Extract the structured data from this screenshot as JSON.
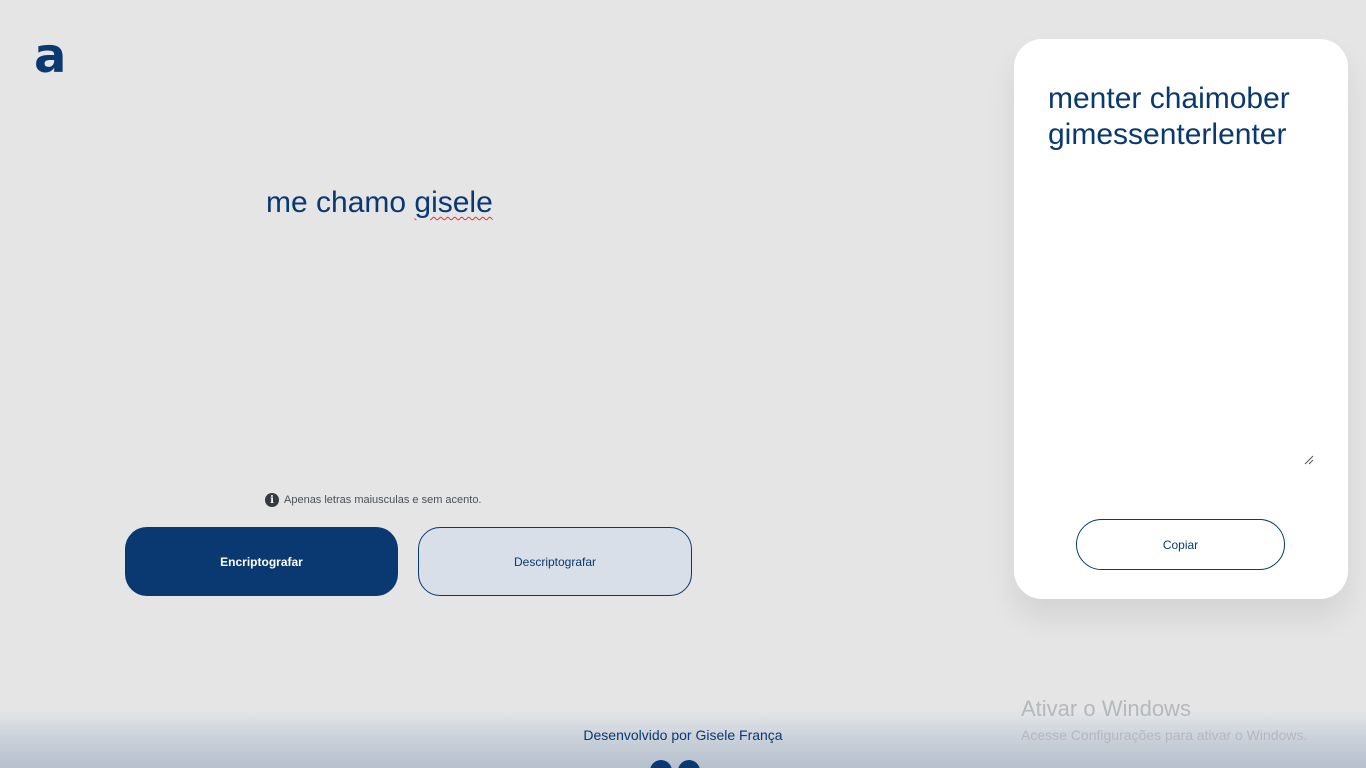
{
  "logo": {
    "text": "a"
  },
  "input": {
    "value_plain": "me chamo ",
    "value_misspelled": "gisele"
  },
  "hint": {
    "icon": "info-icon",
    "text": "Apenas letras maiusculas e sem acento."
  },
  "buttons": {
    "encrypt": "Encriptografar",
    "decrypt": "Descriptografar"
  },
  "output": {
    "value": "menter chaimober gimessenterlenter",
    "copy_label": "Copiar"
  },
  "footer": {
    "credit": "Desenvolvido por Gisele França"
  },
  "watermark": {
    "title": "Ativar o Windows",
    "subtitle": "Acesse Configurações para ativar o Windows."
  },
  "colors": {
    "primary": "#0a3871",
    "background": "#e5e5e5",
    "secondary_button": "#d8dfe8",
    "card": "#ffffff"
  }
}
